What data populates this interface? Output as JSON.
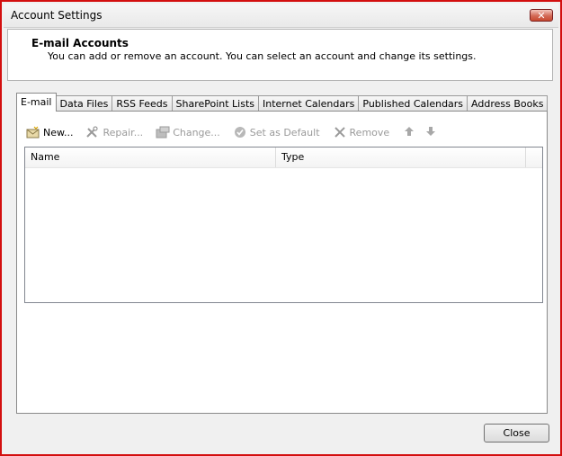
{
  "window": {
    "title": "Account Settings",
    "close_glyph": "✕"
  },
  "header": {
    "title": "E-mail Accounts",
    "subtitle": "You can add or remove an account. You can select an account and change its settings."
  },
  "tabs": [
    {
      "label": "E-mail",
      "active": true
    },
    {
      "label": "Data Files",
      "active": false
    },
    {
      "label": "RSS Feeds",
      "active": false
    },
    {
      "label": "SharePoint Lists",
      "active": false
    },
    {
      "label": "Internet Calendars",
      "active": false
    },
    {
      "label": "Published Calendars",
      "active": false
    },
    {
      "label": "Address Books",
      "active": false
    }
  ],
  "toolbar": {
    "new_label": "New...",
    "repair_label": "Repair...",
    "change_label": "Change...",
    "set_default_label": "Set as Default",
    "remove_label": "Remove",
    "icons": {
      "new": "new-account-icon",
      "repair": "repair-tools-icon",
      "change": "change-icon",
      "set_default": "checkmark-icon",
      "remove": "x-icon",
      "move_up": "arrow-up-icon",
      "move_down": "arrow-down-icon"
    }
  },
  "accounts_list": {
    "columns": [
      "Name",
      "Type"
    ],
    "rows": []
  },
  "footer": {
    "close_label": "Close"
  },
  "colors": {
    "window_border": "#d30f0f",
    "dialog_bg": "#f0f0f0",
    "disabled_text": "#9a9a9a"
  }
}
